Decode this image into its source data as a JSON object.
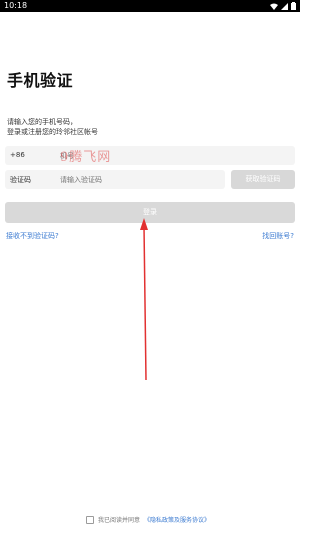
{
  "status_bar": {
    "time": "10:18"
  },
  "page": {
    "title": "手机验证",
    "subtitle_lines": [
      "请输入您的手机号码，",
      "登录或注册您的玲邻社区帐号"
    ]
  },
  "phone": {
    "prefix": "+86",
    "placeholder": "机号"
  },
  "code": {
    "label": "验证码",
    "placeholder": "请输入验证码",
    "get_code_button": "获取验证码"
  },
  "login_button": "登录",
  "links": {
    "no_code": "接收不到验证码?",
    "retrieve_account": "找回账号?"
  },
  "agreement": {
    "text": "我已阅读并同意",
    "policy_link": "《隐私政策及服务协议》"
  },
  "watermark_text": "9腾飞网",
  "colors": {
    "link": "#3c7bd1",
    "annotation_arrow": "#e23131",
    "button_disabled": "#d9d9d9"
  }
}
